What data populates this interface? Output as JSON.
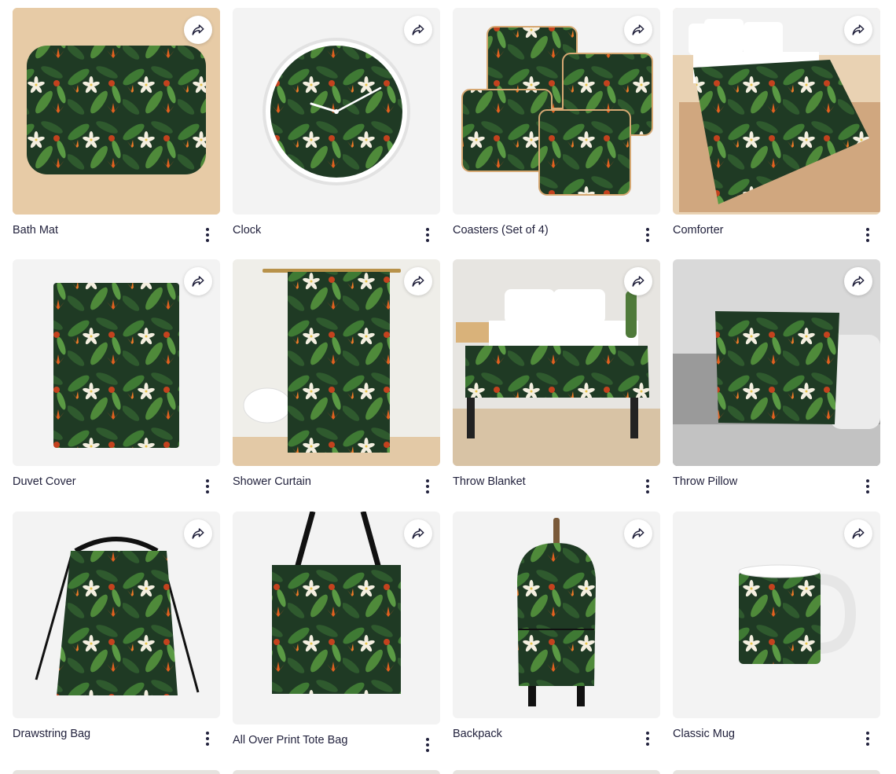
{
  "products": [
    {
      "title": "Bath Mat",
      "share_icon": "share-icon",
      "more_icon": "more-vertical-icon"
    },
    {
      "title": "Clock",
      "share_icon": "share-icon",
      "more_icon": "more-vertical-icon"
    },
    {
      "title": "Coasters (Set of 4)",
      "share_icon": "share-icon",
      "more_icon": "more-vertical-icon"
    },
    {
      "title": "Comforter",
      "share_icon": "share-icon",
      "more_icon": "more-vertical-icon"
    },
    {
      "title": "Duvet Cover",
      "share_icon": "share-icon",
      "more_icon": "more-vertical-icon"
    },
    {
      "title": "Shower Curtain",
      "share_icon": "share-icon",
      "more_icon": "more-vertical-icon"
    },
    {
      "title": "Throw Blanket",
      "share_icon": "share-icon",
      "more_icon": "more-vertical-icon"
    },
    {
      "title": "Throw Pillow",
      "share_icon": "share-icon",
      "more_icon": "more-vertical-icon"
    },
    {
      "title": "Drawstring Bag",
      "share_icon": "share-icon",
      "more_icon": "more-vertical-icon"
    },
    {
      "title": "All Over Print Tote Bag",
      "share_icon": "share-icon",
      "more_icon": "more-vertical-icon"
    },
    {
      "title": "Backpack",
      "share_icon": "share-icon",
      "more_icon": "more-vertical-icon"
    },
    {
      "title": "Classic Mug",
      "share_icon": "share-icon",
      "more_icon": "more-vertical-icon"
    }
  ],
  "colors": {
    "leaf_dark": "#1f3a24",
    "leaf_mid": "#2f5a2e",
    "leaf_light": "#4f8a3a",
    "flower_white": "#f4efe0",
    "flower_orange": "#e2601f",
    "text": "#22223d",
    "card_bg": "#f3f3f3"
  }
}
